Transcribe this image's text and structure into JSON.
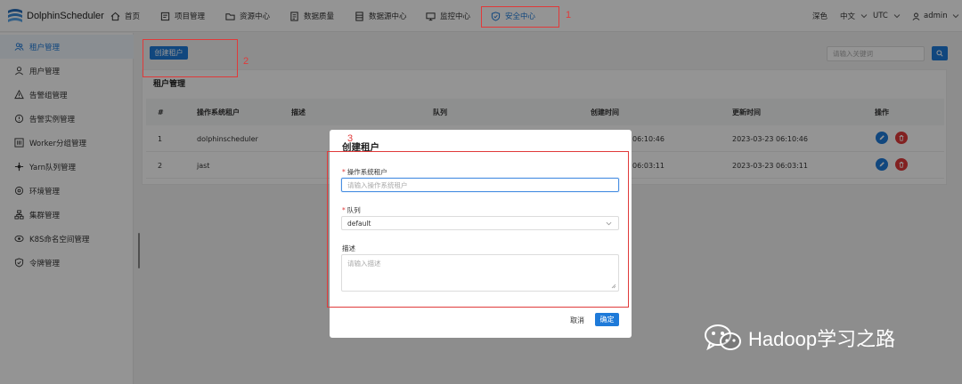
{
  "app": {
    "name": "DolphinScheduler"
  },
  "nav": {
    "items": [
      {
        "label": "首页",
        "icon": "home-icon"
      },
      {
        "label": "项目管理",
        "icon": "project-icon"
      },
      {
        "label": "资源中心",
        "icon": "folder-icon"
      },
      {
        "label": "数据质量",
        "icon": "quality-icon"
      },
      {
        "label": "数据源中心",
        "icon": "datasource-icon"
      },
      {
        "label": "监控中心",
        "icon": "monitor-icon"
      },
      {
        "label": "安全中心",
        "icon": "shield-icon",
        "active": true
      }
    ],
    "theme": "深色",
    "language": "中文",
    "timezone": "UTC",
    "user": "admin"
  },
  "sidebar": {
    "items": [
      {
        "label": "租户管理",
        "icon": "tenant-icon",
        "active": true
      },
      {
        "label": "用户管理",
        "icon": "user-icon"
      },
      {
        "label": "告警组管理",
        "icon": "warning-icon"
      },
      {
        "label": "告警实例管理",
        "icon": "alert-instance-icon"
      },
      {
        "label": "Worker分组管理",
        "icon": "worker-group-icon"
      },
      {
        "label": "Yarn队列管理",
        "icon": "yarn-queue-icon"
      },
      {
        "label": "环境管理",
        "icon": "environment-icon"
      },
      {
        "label": "集群管理",
        "icon": "cluster-icon"
      },
      {
        "label": "K8S命名空间管理",
        "icon": "k8s-namespace-icon"
      },
      {
        "label": "令牌管理",
        "icon": "token-icon"
      }
    ]
  },
  "main": {
    "create_button": "创建租户",
    "search_placeholder": "请输入关键词",
    "card_title": "租户管理",
    "table": {
      "headers": [
        "#",
        "操作系统租户",
        "描述",
        "队列",
        "创建时间",
        "更新时间",
        "操作"
      ],
      "rows": [
        {
          "index": "1",
          "tenant": "dolphinscheduler",
          "desc": "",
          "queue": "",
          "created": "06:10:46",
          "updated": "2023-03-23 06:10:46"
        },
        {
          "index": "2",
          "tenant": "jast",
          "desc": "",
          "queue": "",
          "created": "06:03:11",
          "updated": "2023-03-23 06:03:11"
        }
      ]
    }
  },
  "modal": {
    "title": "创建租户",
    "tenant_label": "操作系统租户",
    "tenant_placeholder": "请输入操作系统租户",
    "queue_label": "队列",
    "queue_value": "default",
    "desc_label": "描述",
    "desc_placeholder": "请输入描述",
    "cancel": "取消",
    "confirm": "确定"
  },
  "annotations": [
    "1",
    "2",
    "3"
  ],
  "watermark": "Hadoop学习之路",
  "colors": {
    "accent": "#1e7ad9",
    "danger": "#e03a3a",
    "annotation": "#e03a3a"
  }
}
